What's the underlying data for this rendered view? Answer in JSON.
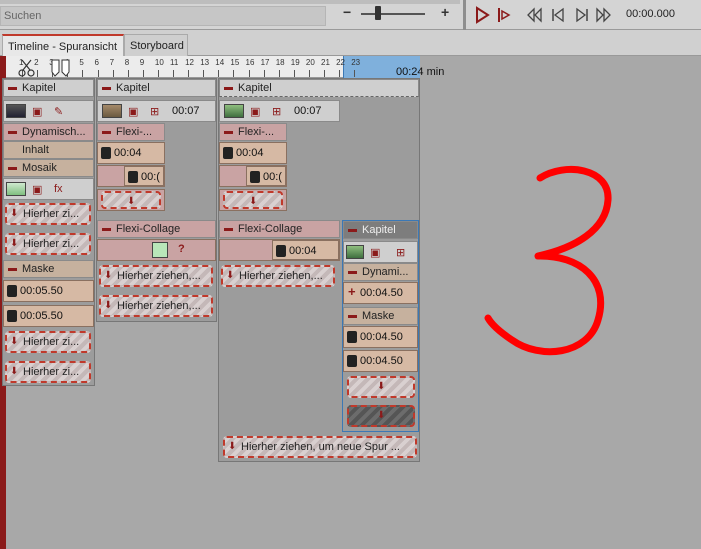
{
  "search": {
    "placeholder": "Suchen"
  },
  "zoom": {
    "minus": "−",
    "plus": "+"
  },
  "timecode": "00:00.000",
  "tabs": {
    "timeline": "Timeline - Spuransicht",
    "storyboard": "Storyboard"
  },
  "ruler": {
    "ticks": [
      "1",
      "2",
      "3",
      "4",
      "5",
      "6",
      "7",
      "8",
      "9",
      "10",
      "11",
      "12",
      "13",
      "14",
      "15",
      "16",
      "17",
      "18",
      "19",
      "20",
      "21",
      "22",
      "23"
    ],
    "label": "00:24 min"
  },
  "col1": {
    "kapitel": "Kapitel",
    "dynamisch": "Dynamisch...",
    "inhalt": "Inhalt",
    "mosaik": "Mosaik",
    "drop1": "Hierher zi...",
    "drop2": "Hierher zi...",
    "maske": "Maske",
    "clip1": "00:05.50",
    "clip2": "00:05.50",
    "drop3": "Hierher zi...",
    "drop4": "Hierher zi..."
  },
  "col2": {
    "kapitel": "Kapitel",
    "time": "00:07",
    "flexi": "Flexi-...",
    "clip1": "00:04",
    "clip2": "00:(",
    "flexicollage": "Flexi-Collage",
    "q": "?",
    "drop1": "Hierher ziehen,...",
    "drop2": "Hierher ziehen,..."
  },
  "col3": {
    "kapitel": "Kapitel",
    "time": "00:07",
    "flexi": "Flexi-...",
    "clip1": "00:04",
    "clip2": "00:(",
    "flexicollage": "Flexi-Collage",
    "clip3": "00:04",
    "drop1": "Hierher ziehen,...",
    "dropbottom": "Hierher ziehen, um neue Spur ..."
  },
  "col4": {
    "kapitel": "Kapitel",
    "dynami": "Dynami...",
    "clip1": "00:04.50",
    "maske": "Maske",
    "clip2": "00:04.50",
    "clip3": "00:04.50"
  },
  "colors": {
    "accent": "#c0392b",
    "annotation": "#ff0000",
    "highlight": "#7fb0dc"
  }
}
